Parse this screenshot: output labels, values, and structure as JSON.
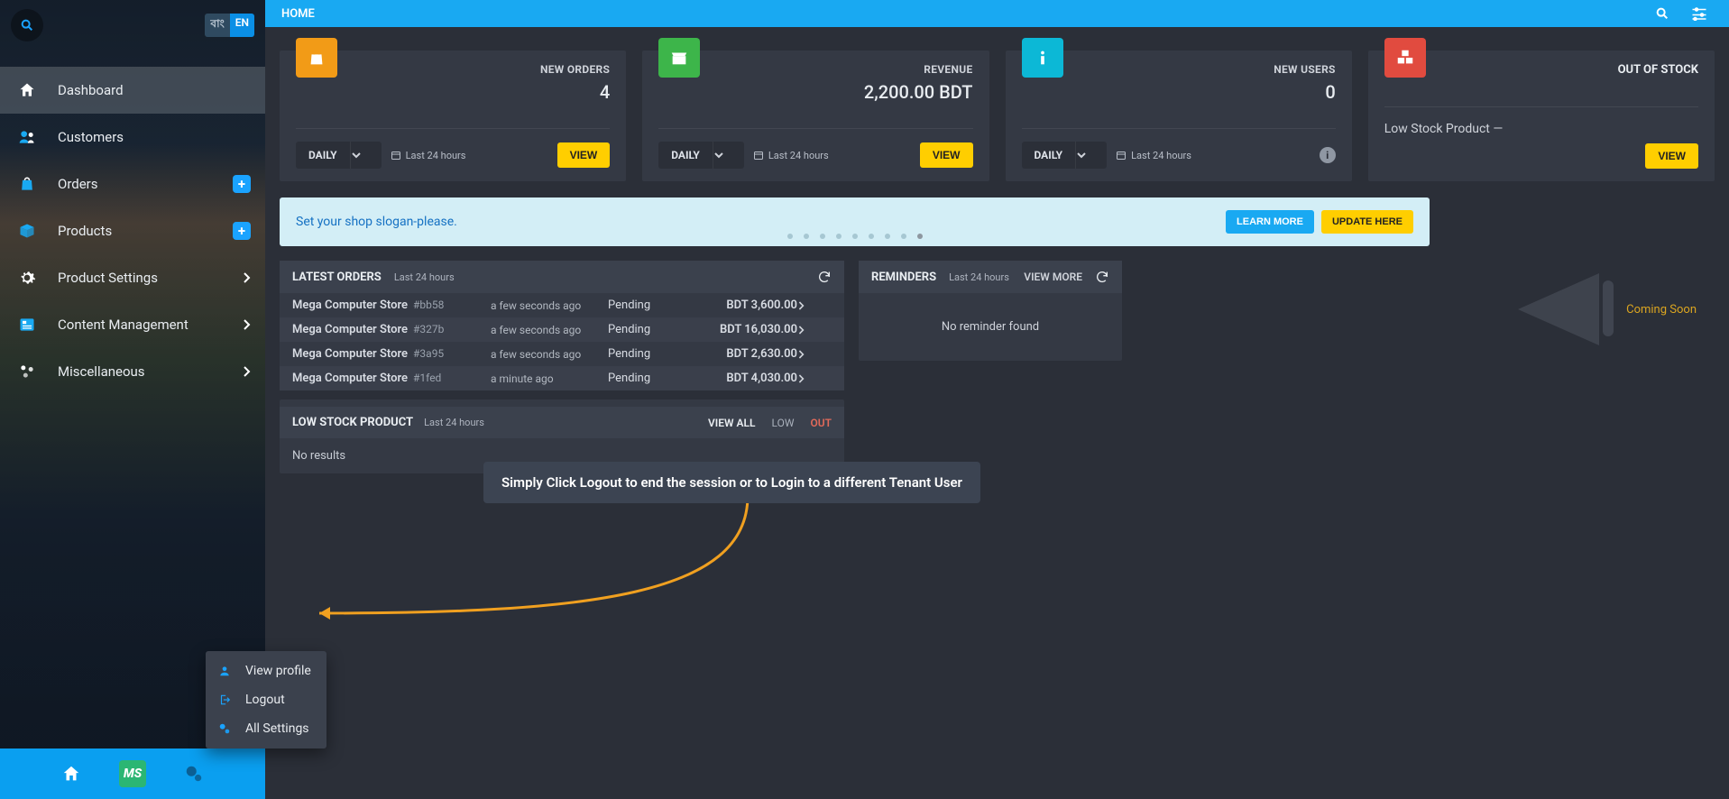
{
  "topbar": {
    "breadcrumb": "HOME"
  },
  "lang": {
    "bn": "বাং",
    "en": "EN"
  },
  "sidebar": {
    "items": [
      {
        "label": "Dashboard"
      },
      {
        "label": "Customers"
      },
      {
        "label": "Orders"
      },
      {
        "label": "Products"
      },
      {
        "label": "Product Settings"
      },
      {
        "label": "Content Management"
      },
      {
        "label": "Miscellaneous"
      }
    ]
  },
  "cards": {
    "orders": {
      "label": "NEW ORDERS",
      "value": "4",
      "period": "DAILY",
      "range": "Last 24 hours",
      "view": "VIEW"
    },
    "revenue": {
      "label": "REVENUE",
      "value": "2,200.00 BDT",
      "period": "DAILY",
      "range": "Last 24 hours",
      "view": "VIEW"
    },
    "users": {
      "label": "NEW USERS",
      "value": "0",
      "period": "DAILY",
      "range": "Last 24 hours"
    },
    "oos": {
      "label": "OUT OF STOCK",
      "low_label": "Low Stock Product —",
      "view": "VIEW"
    }
  },
  "banner": {
    "text": "Set your shop slogan-please.",
    "learn": "LEARN MORE",
    "update": "UPDATE HERE"
  },
  "latest_orders": {
    "title": "LATEST ORDERS",
    "range": "Last 24 hours",
    "rows": [
      {
        "store": "Mega Computer Store",
        "id": "#bb58",
        "time": "a few seconds ago",
        "status": "Pending",
        "amount": "BDT 3,600.00"
      },
      {
        "store": "Mega Computer Store",
        "id": "#327b",
        "time": "a few seconds ago",
        "status": "Pending",
        "amount": "BDT 16,030.00"
      },
      {
        "store": "Mega Computer Store",
        "id": "#3a95",
        "time": "a few seconds ago",
        "status": "Pending",
        "amount": "BDT 2,630.00"
      },
      {
        "store": "Mega Computer Store",
        "id": "#1fed",
        "time": "a minute ago",
        "status": "Pending",
        "amount": "BDT 4,030.00"
      }
    ]
  },
  "low_stock": {
    "title": "LOW STOCK PRODUCT",
    "range": "Last 24 hours",
    "view_all": "VIEW ALL",
    "low": "LOW",
    "out": "OUT",
    "empty": "No results"
  },
  "reminders": {
    "title": "REMINDERS",
    "range": "Last 24 hours",
    "view_more": "VIEW MORE",
    "empty": "No reminder found"
  },
  "coming": {
    "label": "Coming Soon"
  },
  "popup": {
    "profile": "View profile",
    "logout": "Logout",
    "settings": "All Settings"
  },
  "tooltip": {
    "text": "Simply Click Logout to end the session or to Login to a different Tenant User"
  },
  "colors": {
    "accent": "#19a9f2",
    "yellow": "#ffce00",
    "orange": "#f29b17",
    "green": "#3db54a",
    "cyan": "#0cb8d6",
    "red": "#e14b3f"
  }
}
